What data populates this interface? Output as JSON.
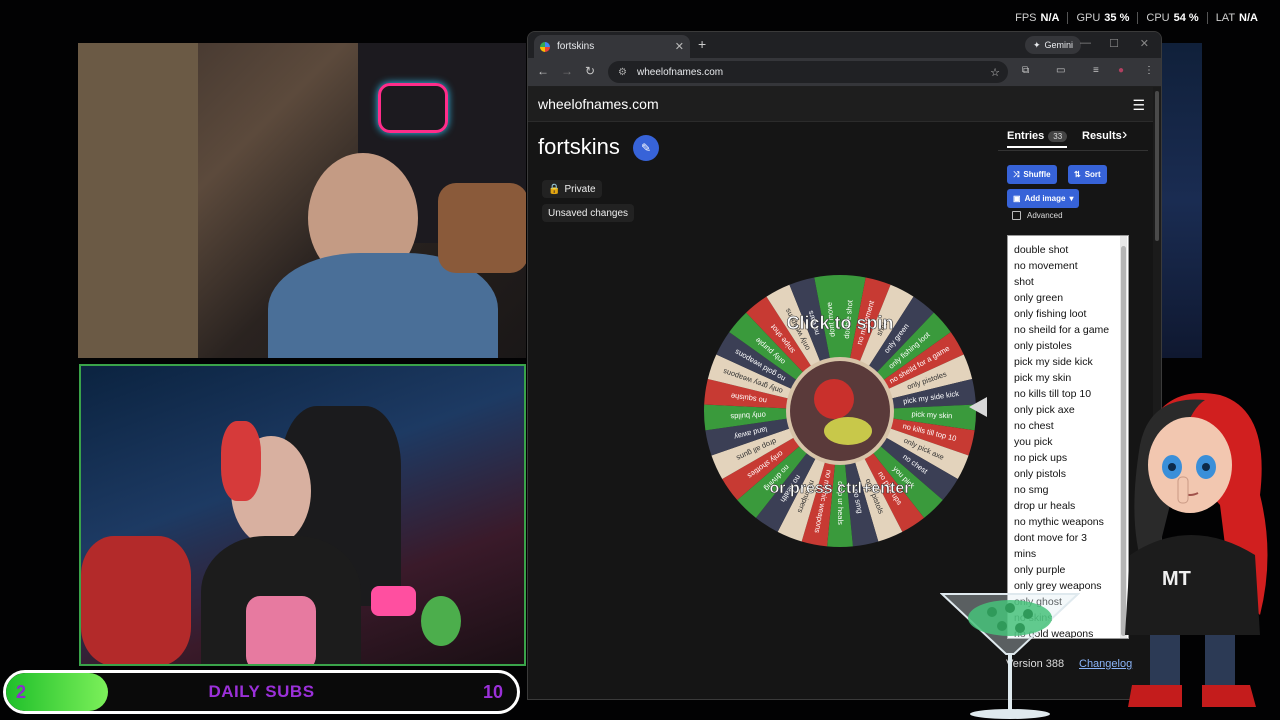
{
  "stats": [
    {
      "label": "FPS",
      "value": "N/A"
    },
    {
      "label": "GPU",
      "value": "35 %"
    },
    {
      "label": "CPU",
      "value": "54 %"
    },
    {
      "label": "LAT",
      "value": "N/A"
    }
  ],
  "subs": {
    "current": "2",
    "label": "DAILY SUBS",
    "goal": "10",
    "progress": 0.2
  },
  "browser": {
    "tab_title": "fortskins",
    "gemini_label": "Gemini",
    "url": "wheelofnames.com"
  },
  "site": {
    "brand": "wheelofnames.com",
    "wheel_title": "fortskins",
    "private_label": "Private",
    "unsaved_label": "Unsaved changes",
    "wheel_top_text": "Click to spin",
    "wheel_bottom_text": "or press ctrl+enter",
    "wheel_labels": [
      "double shot",
      "no movement",
      "shot",
      "only green",
      "only fishing loot",
      "no sheild for a game",
      "only pistoles",
      "pick my side kick",
      "pick my skin",
      "no kills till top 10",
      "only pick axe",
      "no chest",
      "you pick",
      "no pick ups",
      "only pistols",
      "no smg",
      "drop ur heals",
      "no mythic weapons",
      "no snipers",
      "no health",
      "no driving",
      "only shotties",
      "drop all guns",
      "land away",
      "only builds",
      "no squishe",
      "only grey weapons",
      "no gold weapons",
      "only purple",
      "snipe shot",
      "only weapons",
      "no ears",
      "dont move"
    ],
    "wheel_colors": [
      "#3a9a3c",
      "#c73a33",
      "#e3d3bc",
      "#3b3f55"
    ]
  },
  "panel": {
    "tab_entries": "Entries",
    "entries_count": "33",
    "tab_results": "Results",
    "results_count": "0",
    "shuffle_label": "Shuffle",
    "sort_label": "Sort",
    "add_image_label": "Add image",
    "advanced_label": "Advanced",
    "entries": [
      "double shot",
      "no movement",
      "shot",
      "only green",
      "only fishing loot",
      "no sheild for a game",
      "only pistoles",
      "pick my side kick",
      "pick my skin",
      "no kills till top 10",
      "only pick axe",
      "no chest",
      "you pick",
      "no pick ups",
      "only pistols",
      "no smg",
      "drop ur heals",
      "no mythic weapons",
      "dont move for 3",
      "mins",
      "only purple",
      "only grey weapons",
      "only ghost",
      "no skins",
      "no gold weapons"
    ],
    "version": "Version 388",
    "changelog": "Changelog"
  },
  "mascot": {
    "shirt_text": "MT"
  }
}
